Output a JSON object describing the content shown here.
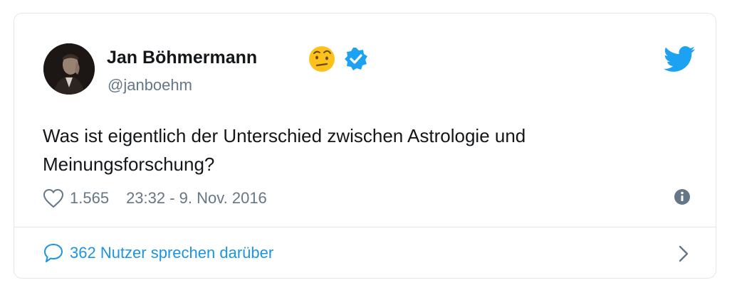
{
  "author": {
    "name": "Jan Böhmermann",
    "handle": "@janboehm",
    "emoji": "face-with-raised-eyebrow-icon",
    "verified": true
  },
  "tweet": {
    "text": "Was ist eigentlich der Unterschied zwischen Astrologie und Meinungsforschung?",
    "likes": "1.565",
    "timestamp": "23:32 - 9. Nov. 2016"
  },
  "footer": {
    "discussion_label": "362 Nutzer sprechen darüber"
  },
  "colors": {
    "twitter_blue": "#1da1f2",
    "link_blue": "#1b95e0",
    "secondary_text": "#657786",
    "border": "#e1e8ed"
  }
}
